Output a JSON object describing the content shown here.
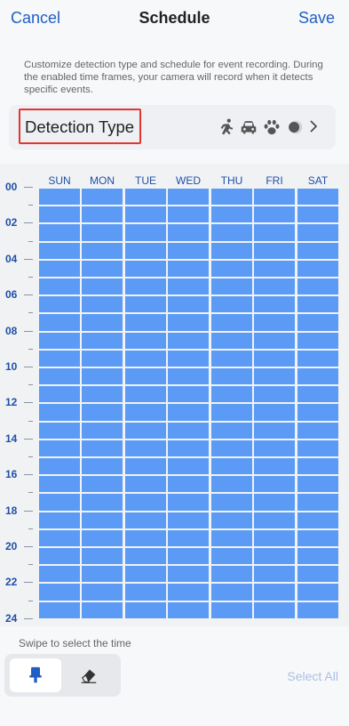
{
  "header": {
    "cancel_label": "Cancel",
    "title": "Schedule",
    "save_label": "Save"
  },
  "description": "Customize detection type and schedule for event recording. During the enabled time frames, your camera will record when it detects specific events.",
  "detection": {
    "label": "Detection Type",
    "icons": [
      "person-running-icon",
      "car-icon",
      "paw-icon",
      "toggle-dot-icon",
      "chevron-right-icon"
    ]
  },
  "schedule": {
    "days": [
      "SUN",
      "MON",
      "TUE",
      "WED",
      "THU",
      "FRI",
      "SAT"
    ],
    "hour_labels": [
      "00",
      "02",
      "04",
      "06",
      "08",
      "10",
      "12",
      "14",
      "16",
      "18",
      "20",
      "22",
      "24"
    ],
    "slots_per_day": 24,
    "enabled_all": true,
    "cell_color": "#5b9bf5"
  },
  "footer": {
    "hint": "Swipe to select the time",
    "tools": [
      {
        "name": "brush-icon",
        "active": true
      },
      {
        "name": "eraser-icon",
        "active": false
      }
    ],
    "select_all_label": "Select All"
  },
  "colors": {
    "accent": "#1f5fc4",
    "highlight_border": "#e3362e",
    "disabled_link": "#a9bfe3"
  }
}
